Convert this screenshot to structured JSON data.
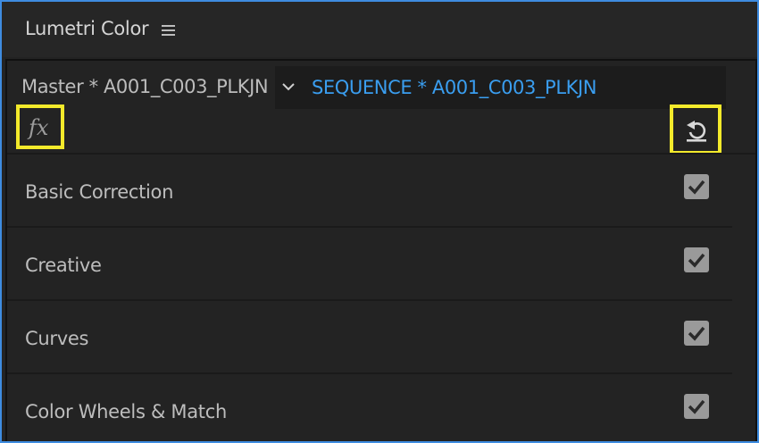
{
  "panel": {
    "title": "Lumetri Color",
    "menu_icon": "hamburger-icon"
  },
  "clip_selector": {
    "master_label": "Master * A001_C003_PLKJN",
    "sequence_label": "SEQUENCE * A001_C003_PLKJN",
    "dropdown_icon": "chevron-down-icon"
  },
  "toolbar": {
    "fx_label": "fx",
    "fx_icon": "fx-icon",
    "reset_icon": "reset-icon",
    "highlight_color": "#f3ea2b"
  },
  "sections": [
    {
      "label": "Basic Correction",
      "enabled": true
    },
    {
      "label": "Creative",
      "enabled": true
    },
    {
      "label": "Curves",
      "enabled": true
    },
    {
      "label": "Color Wheels & Match",
      "enabled": true
    }
  ],
  "colors": {
    "accent_blue": "#3a9ef0",
    "panel_border": "#3e8ce0",
    "background": "#232323"
  }
}
